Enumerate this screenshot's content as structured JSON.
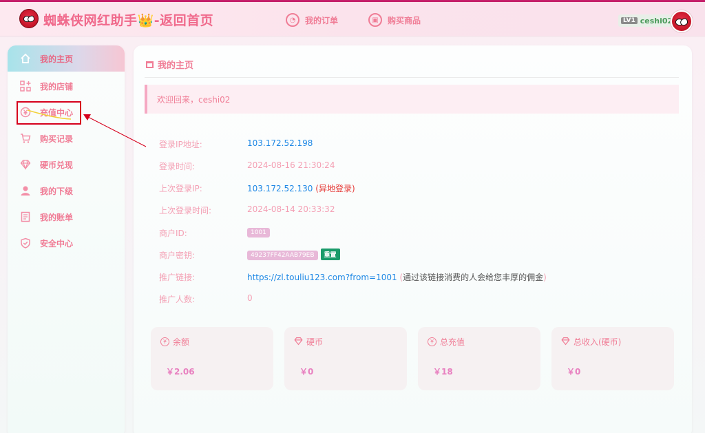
{
  "header": {
    "title": "蜘蛛侠网红助手",
    "crown": "👑",
    "back_link": "-返回首页",
    "nav": [
      {
        "label": "我的订单",
        "icon": "order-icon"
      },
      {
        "label": "购买商品",
        "icon": "shop-icon"
      }
    ],
    "user": {
      "level": "LV1",
      "name": "ceshi02"
    }
  },
  "sidebar": {
    "items": [
      {
        "label": "我的主页",
        "icon": "home-icon"
      },
      {
        "label": "我的店铺",
        "icon": "store-icon"
      },
      {
        "label": "充值中心",
        "icon": "yen-icon"
      },
      {
        "label": "购买记录",
        "icon": "cart-icon"
      },
      {
        "label": "硬币兑现",
        "icon": "diamond-icon"
      },
      {
        "label": "我的下级",
        "icon": "user-icon"
      },
      {
        "label": "我的账单",
        "icon": "bill-icon"
      },
      {
        "label": "安全中心",
        "icon": "shield-icon"
      }
    ]
  },
  "main": {
    "title": "我的主页",
    "welcome": "欢迎回来，ceshi02",
    "info": {
      "login_ip_label": "登录IP地址:",
      "login_ip": "103.172.52.198",
      "login_time_label": "登录时间:",
      "login_time": "2024-08-16 21:30:24",
      "last_ip_label": "上次登录IP:",
      "last_ip": "103.172.52.130",
      "last_ip_note": "(异地登录)",
      "last_time_label": "上次登录时间:",
      "last_time": "2024-08-14 20:33:32",
      "merchant_id_label": "商户ID:",
      "merchant_id": "1001",
      "merchant_key_label": "商户密钥:",
      "merchant_key": "49237FF42AAB79EB",
      "reset_label": "重置",
      "promo_link_label": "推广链接:",
      "promo_link": "https://zl.touliu123.com?from=1001",
      "promo_note_open": "(",
      "promo_note": "通过该链接消费的人会给您丰厚的佣金",
      "promo_note_close": ")",
      "promo_count_label": "推广人数:",
      "promo_count": "0"
    },
    "cards": [
      {
        "label": "余额",
        "value": "￥2.06",
        "icon": "yen-icon"
      },
      {
        "label": "硬币",
        "value": "￥0",
        "icon": "diamond-icon"
      },
      {
        "label": "总充值",
        "value": "￥18",
        "icon": "yen-icon"
      },
      {
        "label": "总收入(硬币)",
        "value": "￥0",
        "icon": "diamond-icon"
      }
    ]
  },
  "colors": {
    "accent": "#f07d96",
    "brand_top": "#c51f6a",
    "highlight": "#d6001c",
    "link": "#1e88e5"
  }
}
